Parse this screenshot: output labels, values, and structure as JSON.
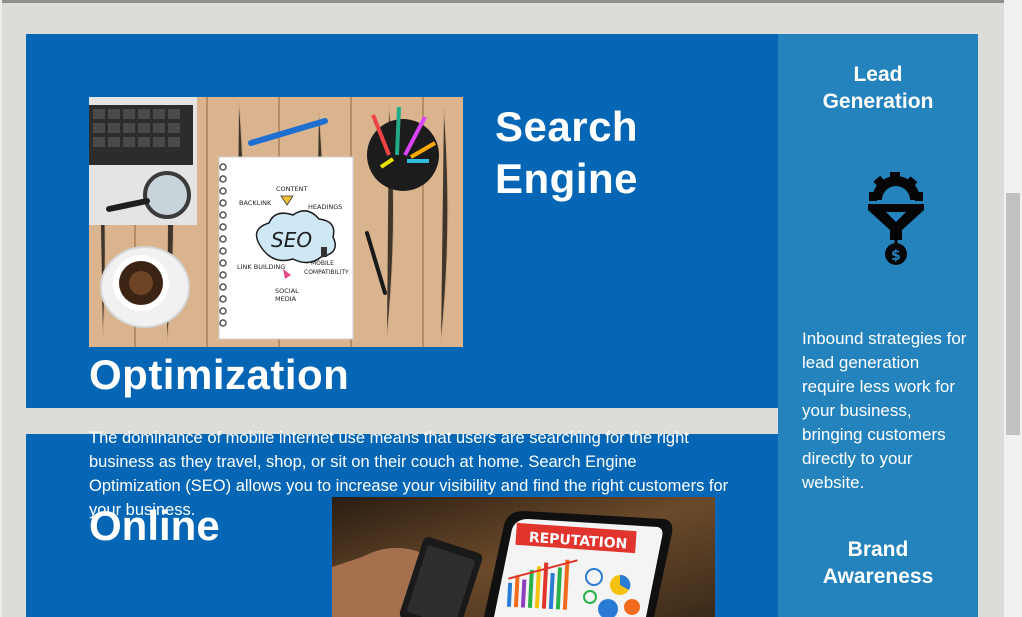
{
  "seo": {
    "title_line1": "Search",
    "title_line2": "Engine",
    "title_line3": "Optimization",
    "description": "The dominance of mobile internet use means that users are searching for the right business as they travel, shop, or sit on their couch at home. Search Engine Optimization (SEO) allows you to increase your visibility and find the right customers for your business.",
    "image_words": {
      "center": "SEO",
      "content": "CONTENT",
      "backlink": "BACKLINK",
      "headings": "HEADINGS",
      "link_building": "LINK BUILDING",
      "mobile": "MOBILE",
      "compatibility": "COMPATIBILITY",
      "social": "SOCIAL",
      "media": "MEDIA"
    }
  },
  "online": {
    "title": "Online",
    "image_banner": "REPUTATION"
  },
  "sidebar": {
    "lead_title_line1": "Lead",
    "lead_title_line2": "Generation",
    "lead_icon": "funnel-gear-dollar-icon",
    "lead_text": "Inbound strategies for lead generation require less work for your business, bringing customers directly to your website.",
    "brand_title_line1": "Brand",
    "brand_title_line2": "Awareness"
  },
  "colors": {
    "panel_blue": "#0466b5",
    "sidebar_blue": "#2483bd",
    "page_bg": "#dcddd8"
  }
}
